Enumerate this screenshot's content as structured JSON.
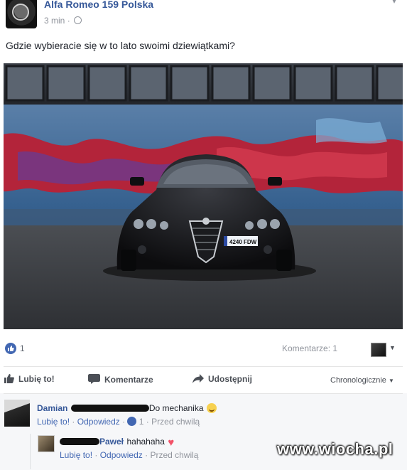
{
  "post": {
    "page_name": "Alfa Romeo 159 Polska",
    "time": "3 min",
    "dot": "·",
    "text": "Gdzie wybieracie się w to lato swoimi dziewiątkami?",
    "photo": {
      "plate": "4240 FDW",
      "alt_icon": "car-photo"
    }
  },
  "reactions": {
    "like_count": "1",
    "comments_label": "Komentarze: 1"
  },
  "actions": {
    "like": "Lubię to!",
    "comment": "Komentarze",
    "share": "Udostępnij",
    "sort": "Chronologicznie"
  },
  "comments": [
    {
      "author": "Damian",
      "text": "Do mechanika",
      "like_link": "Lubię to!",
      "reply_link": "Odpowiedz",
      "like_count": "1",
      "time": "Przed chwilą",
      "reply": {
        "author": "Paweł",
        "text": "hahahaha",
        "like_link": "Lubię to!",
        "reply_link": "Odpowiedz",
        "time": "Przed chwilą"
      }
    }
  ],
  "watermark": "www.wiocha.pl",
  "colors": {
    "link": "#365899",
    "fb_blue": "#4267b2",
    "meta": "#90949c",
    "heart": "#f25268"
  }
}
